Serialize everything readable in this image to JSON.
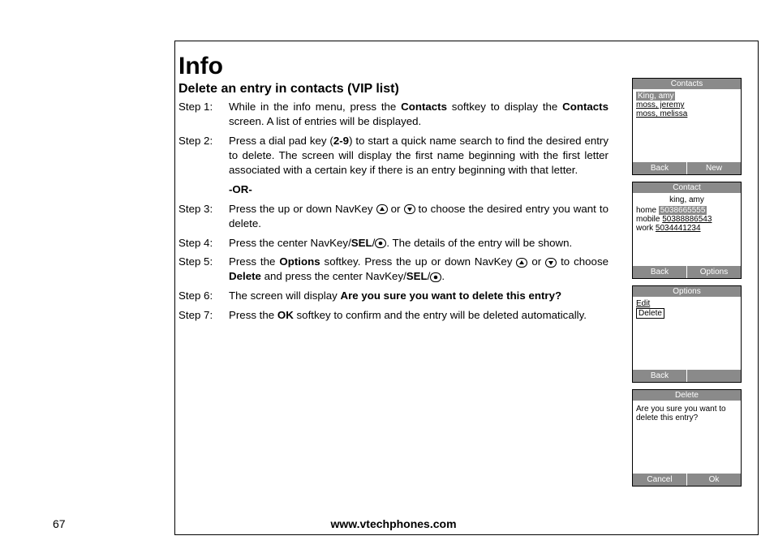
{
  "page_number": "67",
  "footer_url": "www.vtechphones.com",
  "heading": "Info",
  "subheading": "Delete an entry in contacts (VIP list)",
  "steps": [
    {
      "label": "Step 1:",
      "body_html": "While in the info menu, press the <b>Contacts</b> softkey to display the <b>Contacts</b> screen. A list of entries will be displayed."
    },
    {
      "label": "Step 2:",
      "body_html": "Press a dial pad key (<b>2-9</b>) to start a quick name search to find the desired entry to delete. The screen will display the first name beginning with the first letter associated with a certain key if there is an entry beginning with that letter."
    },
    {
      "label": "-OR-",
      "body_html": ""
    },
    {
      "label": "Step 3:",
      "body_html": "Press the up or down NavKey {UP} or {DN} to choose the desired entry you want to delete."
    },
    {
      "label": "Step 4:",
      "body_html": "Press the center NavKey/<b>SEL</b>/{SEL}. The details of the entry will be shown."
    },
    {
      "label": "Step 5:",
      "body_html": "Press the <b>Options</b> softkey. Press the up or down NavKey {UP} or {DN} to choose <b>Delete</b> and press the center NavKey/<b>SEL</b>/{SEL}."
    },
    {
      "label": "Step 6:",
      "body_html": "The screen will display <b>Are you sure you want to delete this entry?</b>"
    },
    {
      "label": "Step 7:",
      "body_html": "Press the <b>OK</b> softkey to confirm and the entry will be deleted automatically."
    }
  ],
  "screens": {
    "contacts": {
      "title": "Contacts",
      "items": [
        {
          "name": "King, amy",
          "selected": true
        },
        {
          "name": "moss, jeremy",
          "selected": false
        },
        {
          "name": "moss, melissa",
          "selected": false
        }
      ],
      "left": "Back",
      "right": "New"
    },
    "contact": {
      "title": "Contact",
      "name": "king, amy",
      "rows": [
        {
          "label": "home",
          "value": "5038665555",
          "selected": true
        },
        {
          "label": "mobile",
          "value": "50388886543",
          "selected": false
        },
        {
          "label": "work",
          "value": "5034441234",
          "selected": false
        }
      ],
      "left": "Back",
      "right": "Options"
    },
    "options": {
      "title": "Options",
      "items": [
        {
          "name": "Edit",
          "selected": false
        },
        {
          "name": "Delete",
          "selected": true
        }
      ],
      "left": "Back",
      "right": ""
    },
    "delete": {
      "title": "Delete",
      "message": "Are you sure you want to delete this entry?",
      "left": "Cancel",
      "right": "Ok"
    }
  }
}
